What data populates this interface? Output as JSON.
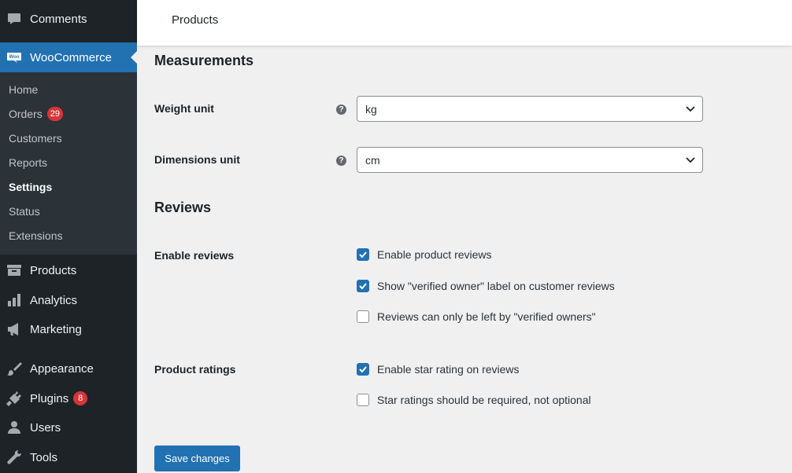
{
  "sidebar": {
    "comments": "Comments",
    "woocommerce": "WooCommerce",
    "woo_icon_text": "Woo",
    "submenu": {
      "home": "Home",
      "orders": "Orders",
      "orders_count": "29",
      "customers": "Customers",
      "reports": "Reports",
      "settings": "Settings",
      "status": "Status",
      "extensions": "Extensions"
    },
    "products": "Products",
    "analytics": "Analytics",
    "marketing": "Marketing",
    "appearance": "Appearance",
    "plugins": "Plugins",
    "plugins_count": "8",
    "users": "Users",
    "tools": "Tools"
  },
  "header": {
    "title": "Products"
  },
  "measurements": {
    "title": "Measurements",
    "weight_label": "Weight unit",
    "weight_value": "kg",
    "dimensions_label": "Dimensions unit",
    "dimensions_value": "cm"
  },
  "reviews": {
    "title": "Reviews",
    "enable_label": "Enable reviews",
    "opt_enable": "Enable product reviews",
    "opt_enable_checked": true,
    "opt_verified_label": "Show \"verified owner\" label on customer reviews",
    "opt_verified_label_checked": true,
    "opt_verified_only": "Reviews can only be left by \"verified owners\"",
    "opt_verified_only_checked": false,
    "ratings_label": "Product ratings",
    "opt_star": "Enable star rating on reviews",
    "opt_star_checked": true,
    "opt_star_required": "Star ratings should be required, not optional",
    "opt_star_required_checked": false
  },
  "actions": {
    "save": "Save changes"
  },
  "colors": {
    "accent": "#2271b1",
    "badge": "#d63638",
    "sidebar_bg": "#1d2327"
  }
}
